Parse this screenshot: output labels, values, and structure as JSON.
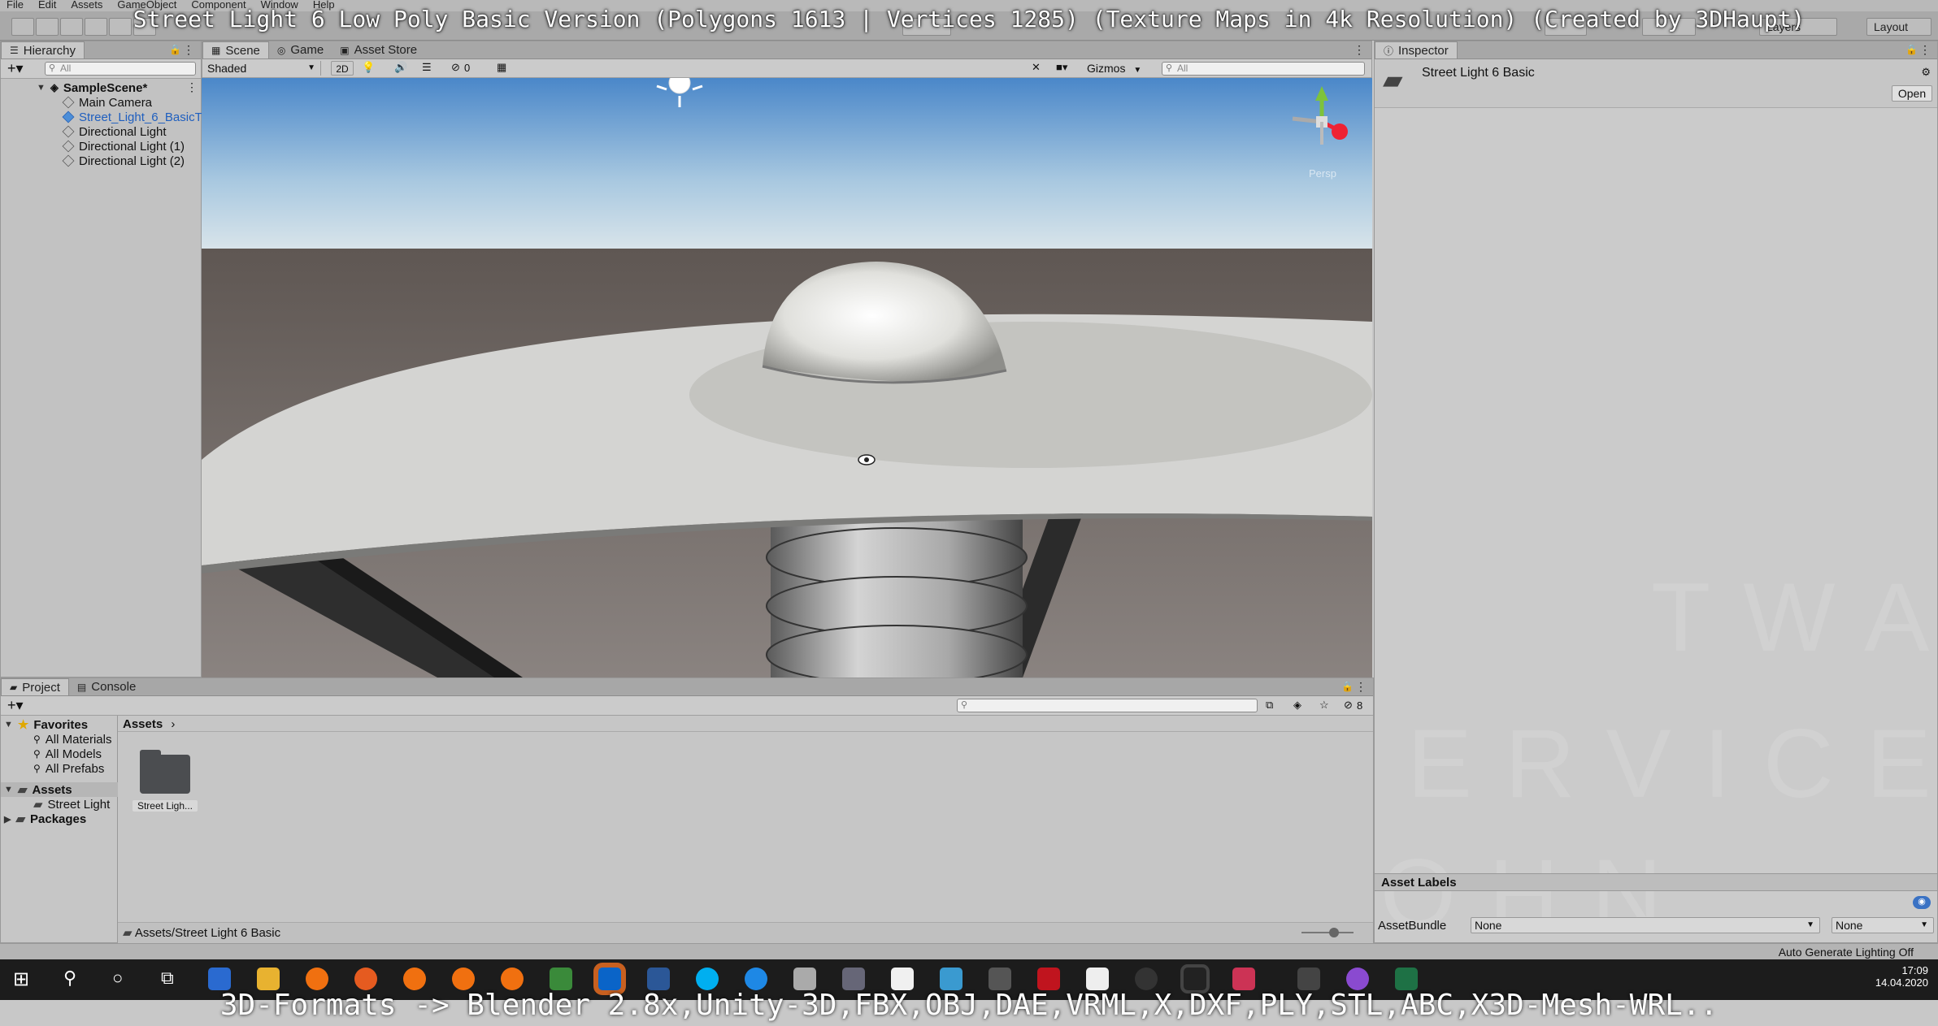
{
  "overlay": {
    "title": "Street Light 6 Low Poly Basic Version (Polygons 1613 | Vertices 1285) (Texture Maps in 4k Resolution) (Created by 3DHaupt)",
    "bottom": "3D-Formats -> Blender 2.8x,Unity-3D,FBX,OBJ,DAE,VRML,X,DXF,PLY,STL,ABC,X3D-Mesh-WRL.."
  },
  "menu": [
    "File",
    "Edit",
    "Assets",
    "GameObject",
    "Component",
    "Window",
    "Help"
  ],
  "toolbar": {
    "layers": "Layers",
    "layout": "Layout"
  },
  "hierarchy": {
    "tab": "Hierarchy",
    "search_placeholder": "All",
    "scene": "SampleScene*",
    "items": [
      "Main Camera",
      "Street_Light_6_BasicT",
      "Directional Light",
      "Directional Light (1)",
      "Directional Light (2)"
    ]
  },
  "scene_view": {
    "tabs": [
      "Scene",
      "Game",
      "Asset Store"
    ],
    "shading": "Shaded",
    "mode_2d": "2D",
    "hidden_count": "0",
    "gizmos": "Gizmos",
    "search_placeholder": "All",
    "persp_label": "Persp"
  },
  "inspector": {
    "tab": "Inspector",
    "asset_name": "Street Light 6 Basic",
    "open_button": "Open",
    "asset_labels": "Asset Labels",
    "asset_bundle_label": "AssetBundle",
    "bundle_value": "None",
    "variant_value": "None"
  },
  "project": {
    "tabs": [
      "Project",
      "Console"
    ],
    "favorites_label": "Favorites",
    "favorites": [
      "All Materials",
      "All Models",
      "All Prefabs"
    ],
    "assets_label": "Assets",
    "asset_children": [
      "Street Light"
    ],
    "packages_label": "Packages",
    "breadcrumb": "Assets",
    "folder_name": "Street Ligh...",
    "path": "Assets/Street Light 6 Basic",
    "filter_count": "8"
  },
  "status": {
    "lighting": "Auto Generate Lighting Off"
  },
  "taskbar": {
    "time": "17:09",
    "date": "14.04.2020"
  },
  "watermark": [
    "TWARE",
    "SERVICE",
    "LOHN"
  ],
  "colors": {
    "accent_tab": "#3a72c4",
    "selected_text": "#1f5fbf"
  }
}
